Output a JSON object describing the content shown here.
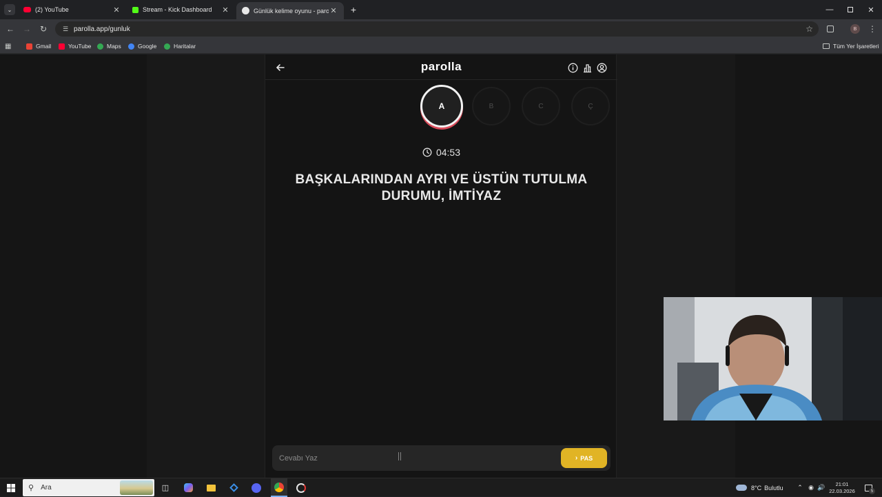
{
  "browser": {
    "tabs": [
      {
        "label": "(2) YouTube",
        "color": "#ff0033"
      },
      {
        "label": "Stream - Kick Dashboard",
        "color": "#53fc18"
      },
      {
        "label": "Günlük kelime oyunu - parolla",
        "color": "#e8e8e8"
      }
    ],
    "url": "parolla.app/gunluk",
    "profile_initial": "B",
    "bookmarks": [
      {
        "label": "Gmail",
        "color": "#ea4335"
      },
      {
        "label": "YouTube",
        "color": "#ff0033"
      },
      {
        "label": "Maps",
        "color": "#34a853"
      },
      {
        "label": "Google",
        "color": "#4285f4"
      },
      {
        "label": "Haritalar",
        "color": "#34a853"
      }
    ],
    "all_bookmarks_label": "Tüm Yer İşaretleri"
  },
  "app": {
    "logo": "parolla",
    "letters": [
      "A",
      "B",
      "C",
      "Ç"
    ],
    "active_letter_index": 0,
    "timer": "04:53",
    "question": "BAŞKALARINDAN AYRI VE ÜSTÜN TUTULMA DURUMU, İMTİYAZ",
    "answer_placeholder": "Cevabı Yaz",
    "pass_label": "PAS",
    "accent_color": "#e1b425",
    "ring_color": "#d94b5a"
  },
  "taskbar": {
    "search_label": "Ara",
    "weather_temp": "8°C",
    "weather_desc": "Bulutlu",
    "time": "21:01",
    "date": "22.03.2026",
    "notification_count": "5"
  }
}
